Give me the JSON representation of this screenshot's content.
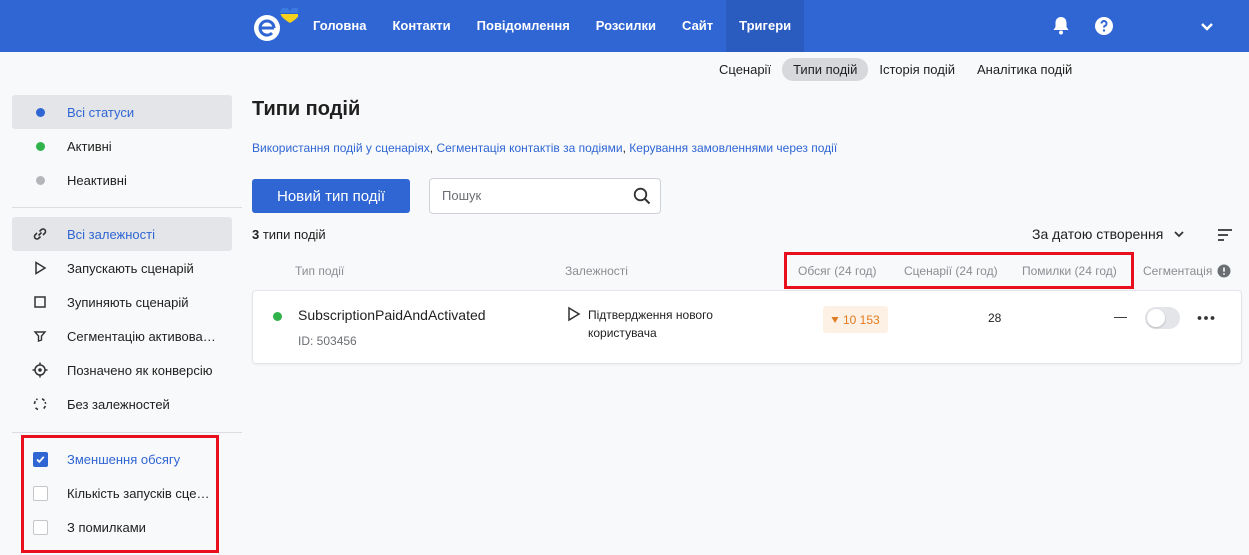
{
  "topbar": {
    "nav": [
      "Головна",
      "Контакти",
      "Повідомлення",
      "Розсилки",
      "Сайт",
      "Тригери"
    ],
    "active_nav": "Тригери",
    "bg_color": "#2f66d4"
  },
  "subnav": {
    "tabs": [
      "Сценарії",
      "Типи подій",
      "Історія подій",
      "Аналітика подій"
    ],
    "active": "Типи подій"
  },
  "sidebar": {
    "statuses": [
      {
        "label": "Всі статуси",
        "color": "#2f66d4",
        "active": true
      },
      {
        "label": "Активні",
        "color": "#2fb34a",
        "active": false
      },
      {
        "label": "Неактивні",
        "color": "#b4b6b9",
        "active": false
      }
    ],
    "dependencies": [
      {
        "label": "Всі залежності",
        "icon": "link-icon",
        "active": true
      },
      {
        "label": "Запускають сценарій",
        "icon": "play-icon",
        "active": false
      },
      {
        "label": "Зупиняють сценарій",
        "icon": "stop-icon",
        "active": false
      },
      {
        "label": "Сегментацію активовано",
        "icon": "filter-icon",
        "active": false
      },
      {
        "label": "Позначено як конверсію",
        "icon": "crosshair-icon",
        "active": false
      },
      {
        "label": "Без залежностей",
        "icon": "broken-link-icon",
        "active": false
      }
    ],
    "filters": [
      {
        "label": "Зменшення обсягу",
        "checked": true
      },
      {
        "label": "Кількість запусків сценаріїв",
        "checked": false
      },
      {
        "label": "З помилками",
        "checked": false
      }
    ]
  },
  "main": {
    "title": "Типи подій",
    "links": [
      "Використання подій у сценаріях",
      "Сегментація контактів за подіями",
      "Керування замовленнями через події"
    ],
    "new_button": "Новий тип події",
    "search_placeholder": "Пошук",
    "count_number": "3",
    "count_text": " типи подій",
    "sort_label": "За датою створення",
    "columns": {
      "type": "Тип події",
      "dependencies": "Залежності",
      "volume": "Обсяг (24 год)",
      "scenarios": "Сценарії (24 год)",
      "errors": "Помилки (24 год)",
      "segmentation": "Сегментація"
    },
    "rows": [
      {
        "name": "SubscriptionPaidAndActivated",
        "id": "ID: 503456",
        "status_color": "#2fb34a",
        "dependency": "Підтвердження нового користувача",
        "volume": "10 153",
        "volume_trend": "down",
        "scenarios": "28",
        "errors": "—",
        "segmentation_on": false
      }
    ]
  },
  "highlight_color": "#e8101c"
}
